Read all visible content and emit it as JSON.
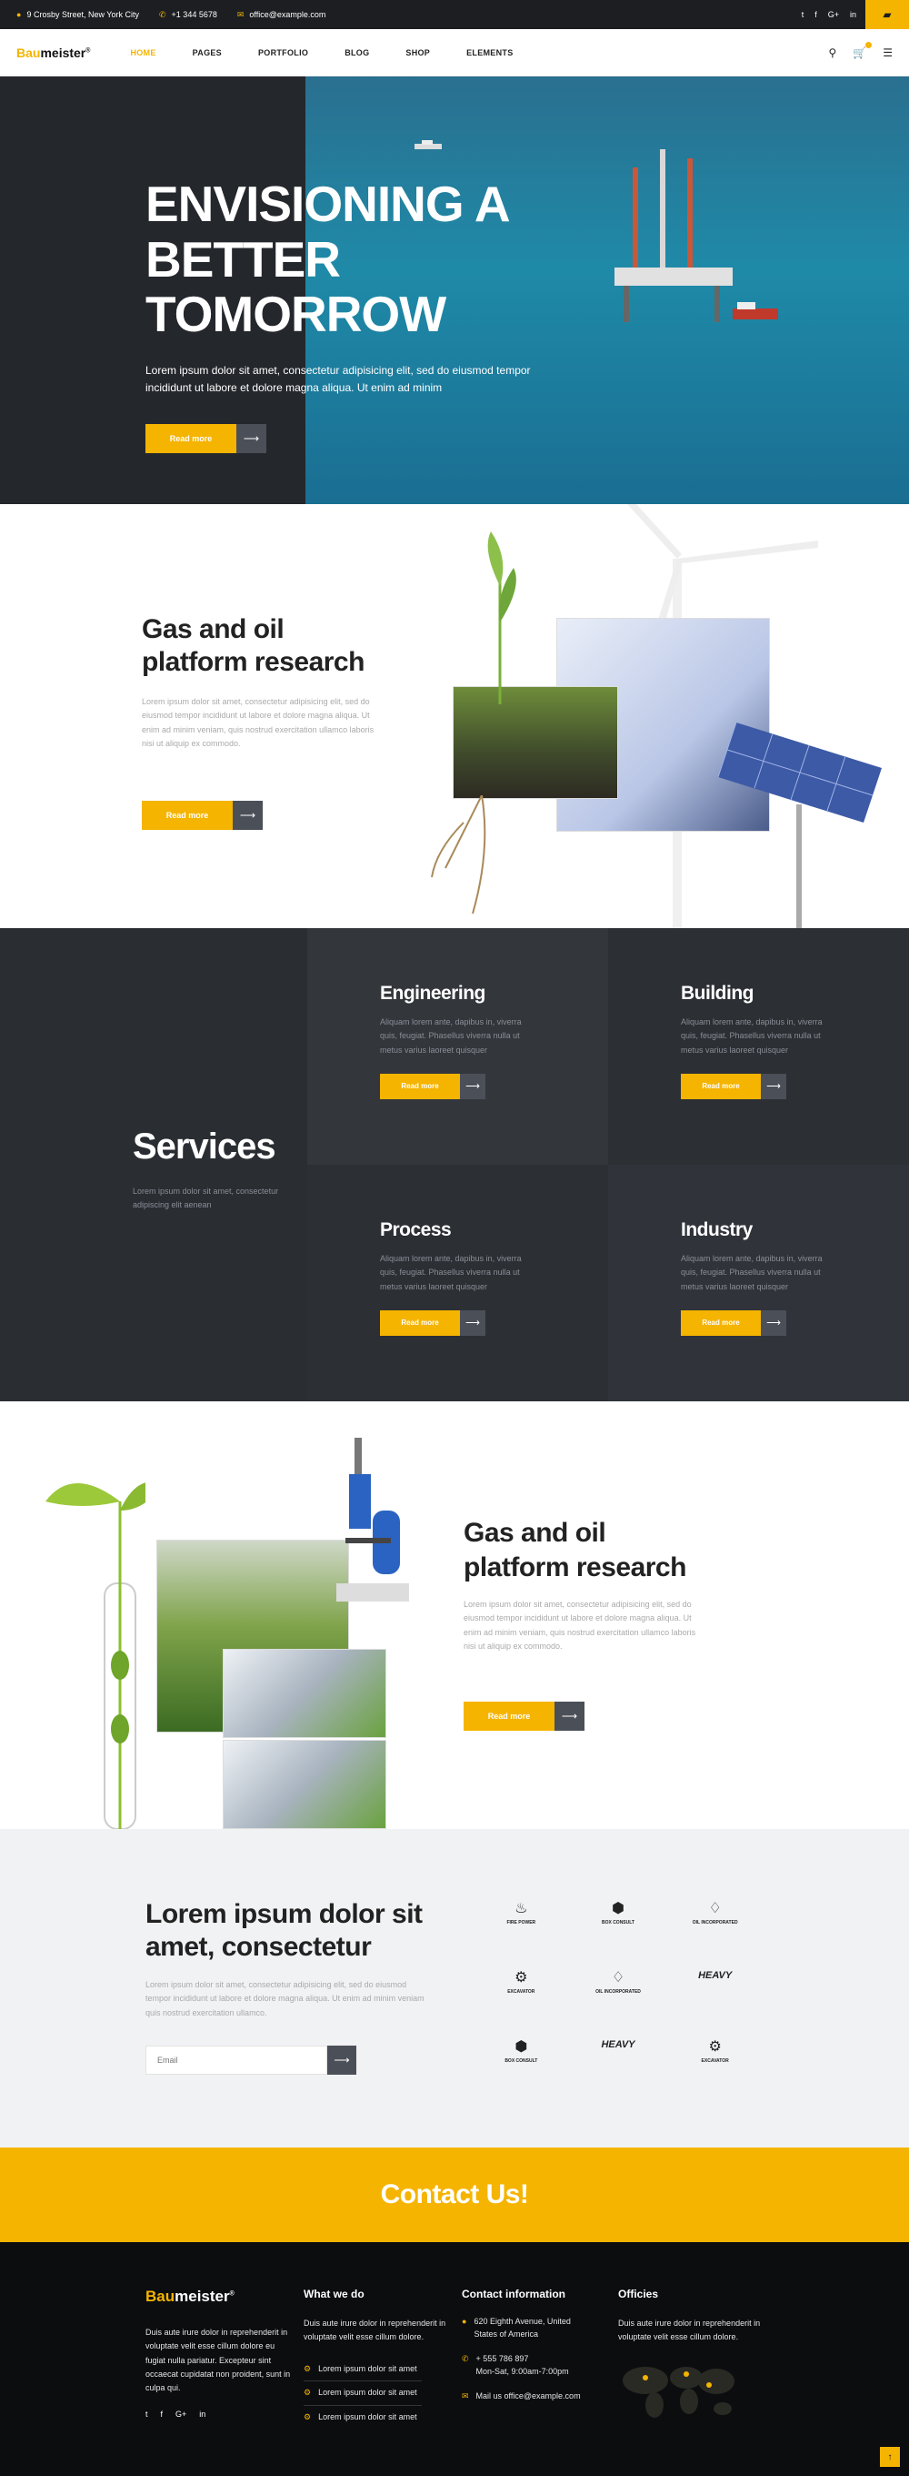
{
  "topbar": {
    "address": "9 Crosby Street, New York City",
    "phone": "+1 344 5678",
    "email": "office@example.com",
    "social": [
      "t",
      "f",
      "G+",
      "in"
    ],
    "corner_icon": "map-icon"
  },
  "header": {
    "logo_prefix": "Bau",
    "logo_suffix": "meister",
    "logo_reg": "®",
    "nav": [
      "HOME",
      "PAGES",
      "PORTFOLIO",
      "BLOG",
      "SHOP",
      "ELEMENTS"
    ],
    "active_nav": "HOME",
    "icons": [
      "search-icon",
      "cart-icon",
      "menu-icon"
    ]
  },
  "hero": {
    "title_line1": "ENVISIONING A",
    "title_line2": "BETTER TOMORROW",
    "text": "Lorem ipsum dolor sit amet, consectetur adipisicing elit, sed do eiusmod tempor incididunt ut labore et dolore magna aliqua. Ut enim ad minim",
    "button_label": "Read more"
  },
  "research1": {
    "title_line1": "Gas and oil",
    "title_line2": "platform research",
    "text": "Lorem ipsum dolor sit amet, consectetur adipisicing elit, sed do eiusmod tempor incididunt ut labore et dolore magna aliqua. Ut enim ad minim veniam, quis nostrud exercitation ullamco laboris nisi ut aliquip ex commodo.",
    "button_label": "Read more"
  },
  "services": {
    "title": "Services",
    "desc": "Lorem ipsum dolor sit amet, consectetur adipiscing elit aenean",
    "items": [
      {
        "title": "Engineering",
        "text": "Aliquam lorem ante, dapibus in, viverra quis, feugiat. Phasellus viverra nulla ut metus varius laoreet quisquer",
        "button": "Read more"
      },
      {
        "title": "Building",
        "text": "Aliquam lorem ante, dapibus in, viverra quis, feugiat. Phasellus viverra nulla ut metus varius laoreet quisquer",
        "button": "Read more"
      },
      {
        "title": "Process",
        "text": "Aliquam lorem ante, dapibus in, viverra quis, feugiat. Phasellus viverra nulla ut metus varius laoreet quisquer",
        "button": "Read more"
      },
      {
        "title": "Industry",
        "text": "Aliquam lorem ante, dapibus in, viverra quis, feugiat. Phasellus viverra nulla ut metus varius laoreet quisquer",
        "button": "Read more"
      }
    ]
  },
  "research2": {
    "title_line1": "Gas and oil",
    "title_line2": "platform research",
    "text": "Lorem ipsum dolor sit amet, consectetur adipisicing elit, sed do eiusmod tempor incididunt ut labore et dolore magna aliqua. Ut enim ad minim veniam, quis nostrud exercitation ullamco laboris nisi ut aliquip ex commodo.",
    "button_label": "Read more"
  },
  "newsletter": {
    "title_line1": "Lorem ipsum dolor sit",
    "title_line2": "amet, consectetur",
    "text": "Lorem ipsum dolor sit amet, consectetur adipisicing elit, sed do eiusmod tempor incididunt ut labore et dolore magna aliqua. Ut enim ad minim veniam quis nostrud exercitation ullamco.",
    "email_placeholder": "Email",
    "partners": [
      {
        "name": "Fire Power",
        "glyph": "♨"
      },
      {
        "name": "Box Consult",
        "glyph": "⬢"
      },
      {
        "name": "Oil Incorporated",
        "glyph": "♢"
      },
      {
        "name": "Excavator",
        "glyph": "⚙"
      },
      {
        "name": "Oil Incorporated",
        "glyph": "♢"
      },
      {
        "name": "Heavy",
        "glyph": "HEAVY"
      },
      {
        "name": "Box Consult",
        "glyph": "⬢"
      },
      {
        "name": "Heavy",
        "glyph": "HEAVY"
      },
      {
        "name": "Excavator",
        "glyph": "⚙"
      }
    ]
  },
  "contact_banner": {
    "title": "Contact Us!"
  },
  "footer": {
    "logo_prefix": "Bau",
    "logo_suffix": "meister",
    "logo_reg": "®",
    "about": "Duis aute irure dolor in reprehenderit in voluptate velit esse cillum dolore eu fugiat nulla pariatur. Excepteur sint occaecat cupidatat non proident, sunt in culpa qui.",
    "social": [
      "t",
      "f",
      "G+",
      "in"
    ],
    "what_we_do": {
      "title": "What we do",
      "text": "Duis aute irure dolor in reprehenderit in voluptate velit esse cillum dolore.",
      "items": [
        "Lorem ipsum dolor sit amet",
        "Lorem ipsum dolor sit amet",
        "Lorem ipsum dolor sit amet"
      ]
    },
    "contact": {
      "title": "Contact information",
      "address": "620 Eighth Avenue, United States of America",
      "phone": "+ 555 786 897",
      "hours": "Mon-Sat, 9:00am-7:00pm",
      "email": "Mail us office@example.com"
    },
    "offices": {
      "title": "Officies",
      "text": "Duis aute irure dolor in reprehenderit in voluptate velit esse cillum dolore."
    }
  },
  "colors": {
    "accent": "#f5b400",
    "dark": "#24272c",
    "footer": "#0c0d0f"
  }
}
